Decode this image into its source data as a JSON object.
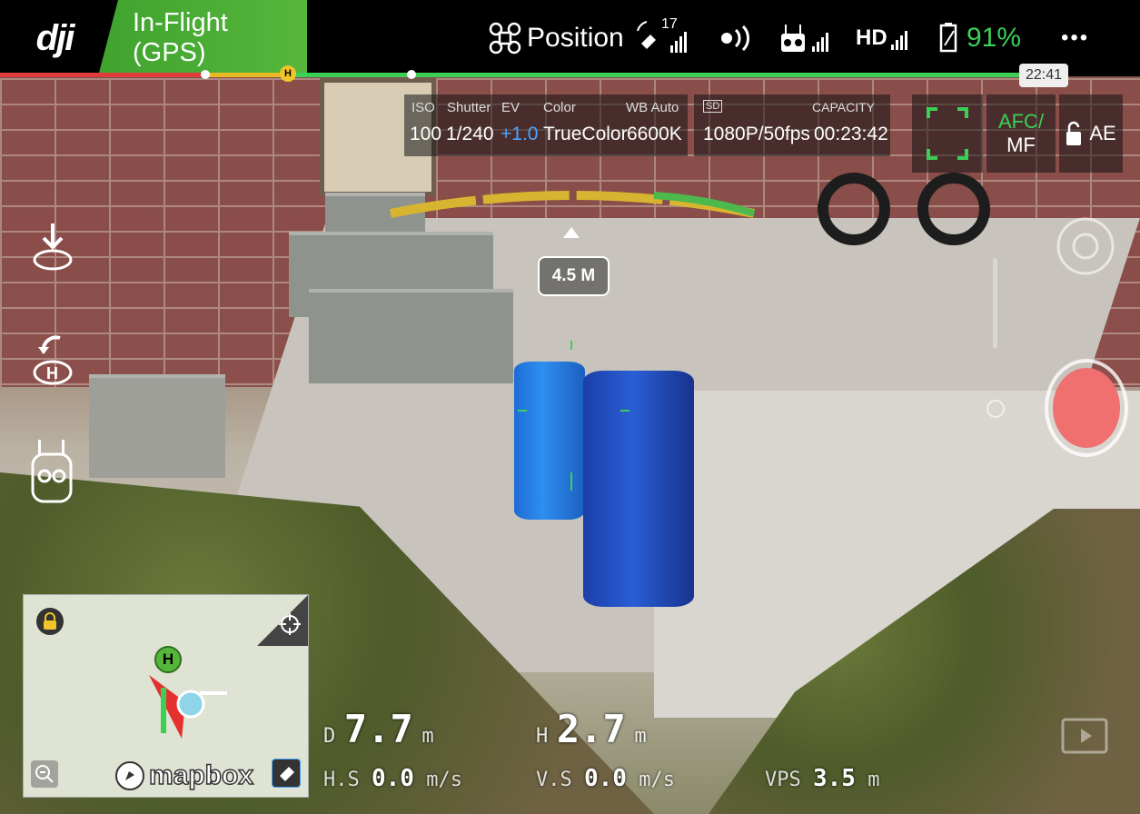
{
  "app": {
    "logo": "dji"
  },
  "status": {
    "flight_mode": "In-Flight (GPS)"
  },
  "topbar": {
    "position_label": "Position",
    "satellites": "17",
    "battery": "91%",
    "more": "•••",
    "hd_label": "HD"
  },
  "timeline": {
    "remaining_time": "22:41",
    "home_marker": "H"
  },
  "camera": {
    "iso_label": "ISO",
    "iso_value": "100",
    "shutter_label": "Shutter",
    "shutter_value": "1/240",
    "ev_label": "EV",
    "ev_value": "+1.0",
    "color_label": "Color",
    "color_value": "TrueColor",
    "wb_label": "WB Auto",
    "wb_value": "6600K",
    "sd_label": "SD",
    "resolution_value": "1080P/50fps",
    "capacity_label": "CAPACITY",
    "capacity_value": "00:23:42",
    "afc_label": "AFC/",
    "mf_label": "MF",
    "ae_label": "AE"
  },
  "obstacle": {
    "distance": "4.5 M"
  },
  "map": {
    "brand": "mapbox",
    "home_marker": "H"
  },
  "telemetry": {
    "d_label": "D",
    "d_value": "7.7",
    "d_unit": "m",
    "h_label": "H",
    "h_value": "2.7",
    "h_unit": "m",
    "hs_label": "H.S",
    "hs_value": "0.0",
    "hs_unit": "m/s",
    "vs_label": "V.S",
    "vs_value": "0.0",
    "vs_unit": "m/s",
    "vps_label": "VPS",
    "vps_value": "3.5",
    "vps_unit": "m"
  },
  "colors": {
    "accent_green": "#3ccf56",
    "status_green": "#56b63c",
    "record_red": "#f07070",
    "ev_blue": "#4aa3ff"
  }
}
